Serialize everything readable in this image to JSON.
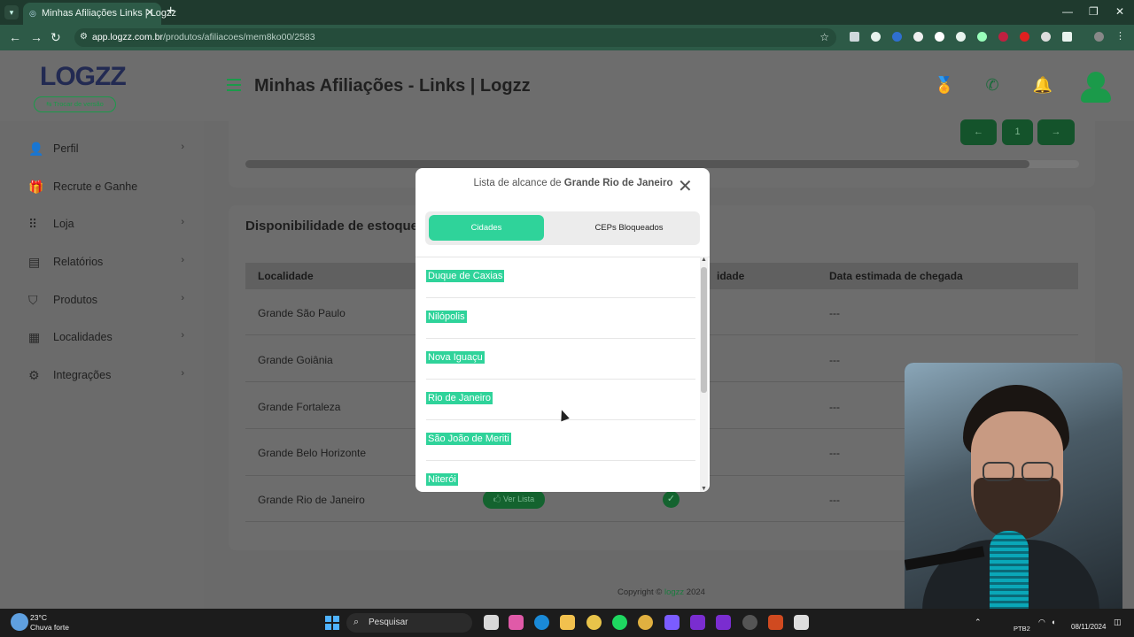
{
  "browser": {
    "tab_title": "Minhas Afiliações Links | Logzz",
    "url_host": "app.logzz.com.br",
    "url_path": "/produtos/afiliacoes/mem8ko00/2583"
  },
  "header": {
    "logo": "LOGZZ",
    "switch_version": "⇆ Trocar de versão",
    "page_title": "Minhas Afiliações - Links | Logzz"
  },
  "sidebar": {
    "items": [
      {
        "label": "Perfil",
        "icon": "user-icon",
        "has_chevron": true
      },
      {
        "label": "Recrute e Ganhe",
        "icon": "gift-icon",
        "has_chevron": false
      },
      {
        "label": "Loja",
        "icon": "grid-icon",
        "has_chevron": true
      },
      {
        "label": "Relatórios",
        "icon": "report-icon",
        "has_chevron": true
      },
      {
        "label": "Produtos",
        "icon": "tag-icon",
        "has_chevron": true
      },
      {
        "label": "Localidades",
        "icon": "building-icon",
        "has_chevron": true
      },
      {
        "label": "Integrações",
        "icon": "integration-icon",
        "has_chevron": true
      }
    ]
  },
  "pagination": {
    "prev": "←",
    "page": "1",
    "next": "→"
  },
  "stock": {
    "title": "Disponibilidade de estoque",
    "columns": [
      "Localidade",
      "idade",
      "Data estimada de chegada"
    ],
    "rows": [
      {
        "location": "Grande São Paulo",
        "eta": "---"
      },
      {
        "location": "Grande Goiânia",
        "eta": "---"
      },
      {
        "location": "Grande Fortaleza",
        "eta": "---"
      },
      {
        "location": "Grande Belo Horizonte",
        "eta": "---"
      },
      {
        "location": "Grande Rio de Janeiro",
        "eta": "---"
      }
    ],
    "ver_lista": "🖒 Ver Lista"
  },
  "modal": {
    "title_prefix": "Lista de alcance de",
    "title_region": "Grande Rio de Janeiro",
    "tab_cities": "Cidades",
    "tab_blocked": "CEPs Bloqueados",
    "cities": [
      "Duque de Caxias",
      "Nilópolis",
      "Nova Iguaçu",
      "Rio de Janeiro",
      "São João de Meriti",
      "Niterói"
    ]
  },
  "footer": {
    "copyright_prefix": "Copyright ©",
    "brand": "logzz",
    "year": "2024"
  },
  "taskbar": {
    "temperature": "23°C",
    "condition": "Chuva forte",
    "search": "Pesquisar",
    "language": "PTB2",
    "date": "08/11/2024"
  },
  "colors": {
    "accent": "#2fd39a",
    "brand_green": "#1b9a4a"
  }
}
